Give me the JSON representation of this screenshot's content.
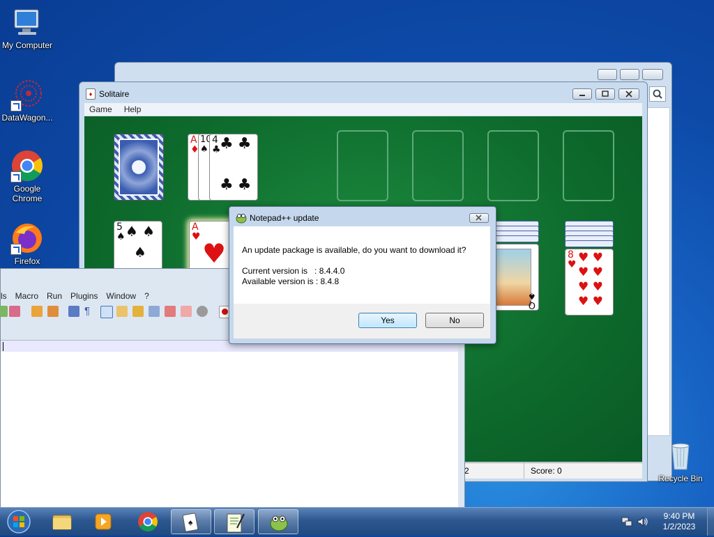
{
  "desktop": {
    "icons": [
      {
        "label": "My Computer"
      },
      {
        "label": "DataWagon..."
      },
      {
        "label": "Google Chrome"
      },
      {
        "label": "Firefox"
      },
      {
        "label": "Recycle Bin"
      }
    ]
  },
  "solitaire": {
    "title": "Solitaire",
    "menu": [
      "Game",
      "Help"
    ],
    "status": {
      "left": "2",
      "score": "Score: 0"
    },
    "cards": {
      "waste": [
        {
          "rank": "A",
          "suit": "♦"
        },
        {
          "rank": "10",
          "suit": "♠"
        },
        {
          "rank": "4",
          "suit": "♣"
        }
      ],
      "tableau_1": {
        "rank": "5",
        "suit": "♠"
      },
      "tableau_2": {
        "rank": "A",
        "suit": "♥"
      },
      "tableau_6": {
        "rank": "Q",
        "suit": "♠"
      },
      "tableau_7": {
        "rank": "8",
        "suit": "♥"
      }
    }
  },
  "notepadpp": {
    "menu": [
      "ls",
      "Macro",
      "Run",
      "Plugins",
      "Window",
      "?"
    ]
  },
  "dialog": {
    "title": "Notepad++ update",
    "message": "An update package is available, do you want to download it?",
    "current_version": "Current version is   : 8.4.4.0",
    "available_version": "Available version is : 8.4.8",
    "yes_label": "Yes",
    "no_label": "No"
  },
  "taskbar": {
    "time": "9:40 PM",
    "date": "1/2/2023"
  }
}
